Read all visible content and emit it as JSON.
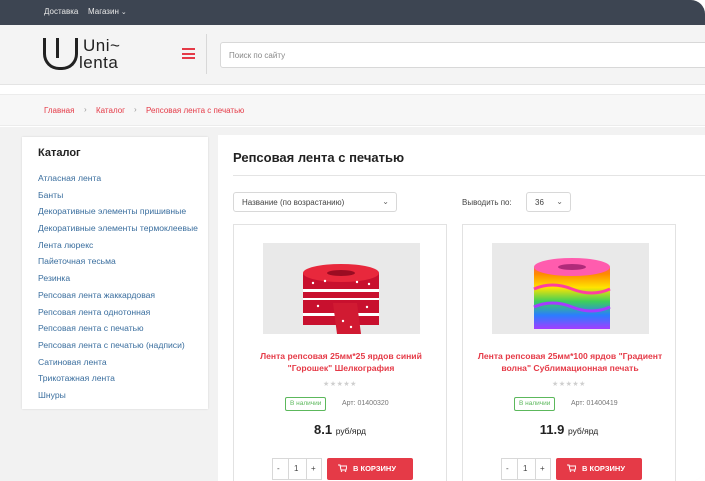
{
  "topbar": {
    "delivery": "Доставка",
    "shop": "Магазин"
  },
  "logo": {
    "line1": "Uni~",
    "line2": "lenta"
  },
  "search": {
    "placeholder": "Поиск по сайту"
  },
  "breadcrumb": [
    "Главная",
    "Каталог",
    "Репсовая лента с печатью"
  ],
  "sidebar": {
    "title": "Каталог",
    "items": [
      "Атласная лента",
      "Банты",
      "Декоративные элементы пришивные",
      "Декоративные элементы термоклеевые",
      "Лента люрекс",
      "Пайеточная тесьма",
      "Резинка",
      "Репсовая лента жаккардовая",
      "Репсовая лента однотонная",
      "Репсовая лента с печатью",
      "Репсовая лента с печатью (надписи)",
      "Сатиновая лента",
      "Трикотажная лента",
      "Шнуры"
    ]
  },
  "main": {
    "title": "Репсовая лента с печатью",
    "sort_value": "Название (по возрастанию)",
    "per_page_label": "Выводить по:",
    "per_page_value": "36"
  },
  "products": [
    {
      "name": "Лента репсовая 25мм*25 ярдов синий \"Горошек\" Шелкография",
      "stock": "В наличии",
      "article": "Арт: 01400320",
      "price": "8.1",
      "unit": "руб/ярд",
      "qty": "1",
      "cart_label": "В КОРЗИНУ"
    },
    {
      "name": "Лента репсовая 25мм*100 ярдов \"Градиент волна\" Сублимационная печать",
      "stock": "В наличии",
      "article": "Арт: 01400419",
      "price": "11.9",
      "unit": "руб/ярд",
      "qty": "1",
      "cart_label": "В КОРЗИНУ"
    }
  ],
  "colors": {
    "accent": "#e53a47",
    "topbar": "#3d4552",
    "link": "#3a6e9e",
    "stock": "#5cb85c"
  },
  "icons": [
    "chevron-down-icon",
    "menu-icon",
    "cart-icon",
    "star-icon"
  ]
}
